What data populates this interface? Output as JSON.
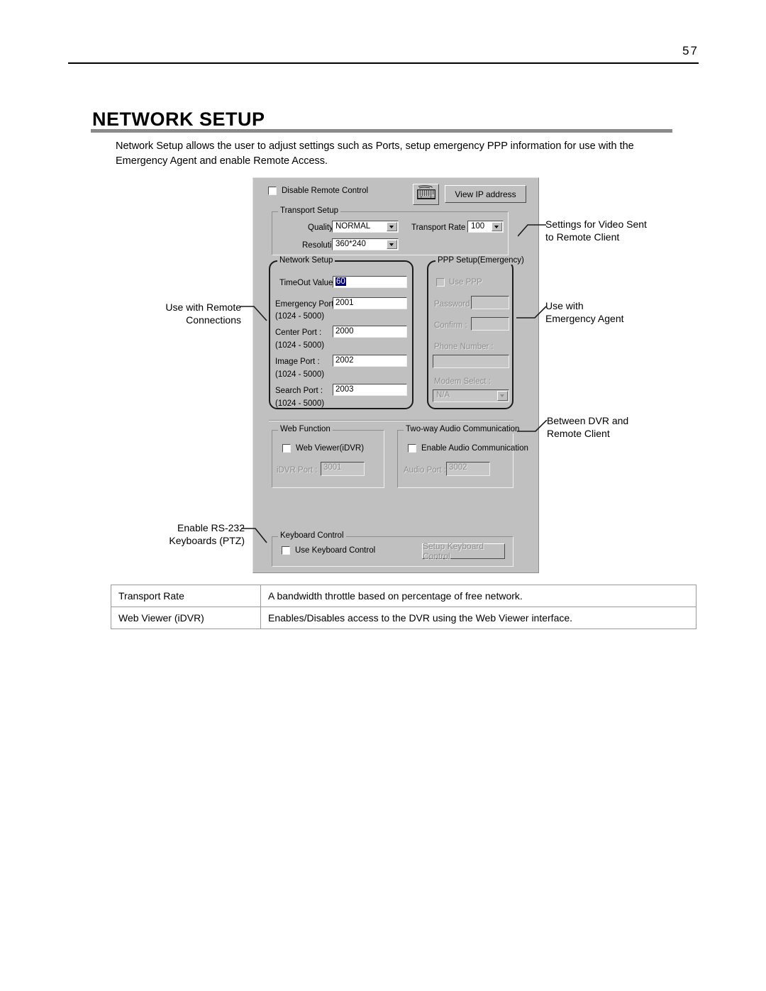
{
  "page": {
    "number": "57",
    "section_title": "NETWORK SETUP",
    "intro": "Network Setup allows the user to adjust settings such as Ports, setup emergency PPP information for use with the Emergency Agent and enable Remote Access."
  },
  "dialog": {
    "disable_remote_control": {
      "label": "Disable Remote Control",
      "checked": false
    },
    "keyboard_icon": "keyboard-icon",
    "view_ip_button": "View  IP address",
    "transport_setup": {
      "title": "Transport Setup",
      "quality_label": "Quality :",
      "quality_value": "NORMAL",
      "resolution_label": "Resolution :",
      "resolution_value": "360*240",
      "transport_rate_label": "Transport Rate :",
      "transport_rate_value": "100"
    },
    "network_setup": {
      "title": "Network Setup",
      "timeout_label": "TimeOut Value :",
      "timeout_value": "60",
      "emergency_port_label": "Emergency Port :",
      "emergency_port_value": "2001",
      "emergency_port_range": "(1024 - 5000)",
      "center_port_label": "Center Port :",
      "center_port_value": "2000",
      "center_port_range": "(1024 - 5000)",
      "image_port_label": "Image Port :",
      "image_port_value": "2002",
      "image_port_range": "(1024 - 5000)",
      "search_port_label": "Search Port :",
      "search_port_value": "2003",
      "search_port_range": "(1024 - 5000)"
    },
    "ppp_setup": {
      "title": "PPP Setup(Emergency)",
      "use_ppp_label": "Use PPP",
      "use_ppp_checked": false,
      "password_label": "Password :",
      "password_value": "",
      "confirm_label": "Confirm :",
      "confirm_value": "",
      "phone_number_label": "Phone Number :",
      "phone_number_value": "",
      "modem_select_label": "Modem Select :",
      "modem_select_value": "N/A"
    },
    "web_function": {
      "title": "Web Function",
      "web_viewer_label": "Web Viewer(iDVR)",
      "web_viewer_checked": false,
      "idvr_port_label": "iDVR Port :",
      "idvr_port_value": "3001"
    },
    "audio": {
      "title": "Two-way Audio Communication",
      "enable_label": "Enable Audio Communication",
      "enable_checked": false,
      "audio_port_label": "Audio Port :",
      "audio_port_value": "3002"
    },
    "keyboard_control": {
      "title": "Keyboard Control",
      "use_label": "Use Keyboard Control",
      "use_checked": false,
      "setup_button": "Setup Keyboard Control"
    }
  },
  "callouts": {
    "video_settings": "Settings for Video Sent\nto Remote Client",
    "video_settings_l1": "Settings for Video Sent",
    "video_settings_l2": "to Remote Client",
    "emergency_agent_l1": "Use with",
    "emergency_agent_l2": "Emergency Agent",
    "between_dvr_l1": "Between DVR and",
    "between_dvr_l2": "Remote Client",
    "remote_connections_l1": "Use with Remote",
    "remote_connections_l2": "Connections",
    "rs232_l1": "Enable RS-232",
    "rs232_l2": "Keyboards (PTZ)"
  },
  "table": {
    "rows": [
      {
        "term": "Transport Rate",
        "description": "A bandwidth throttle based on percentage of free network."
      },
      {
        "term": "Web Viewer (iDVR)",
        "description": "Enables/Disables access to the DVR using the Web Viewer interface."
      }
    ]
  }
}
